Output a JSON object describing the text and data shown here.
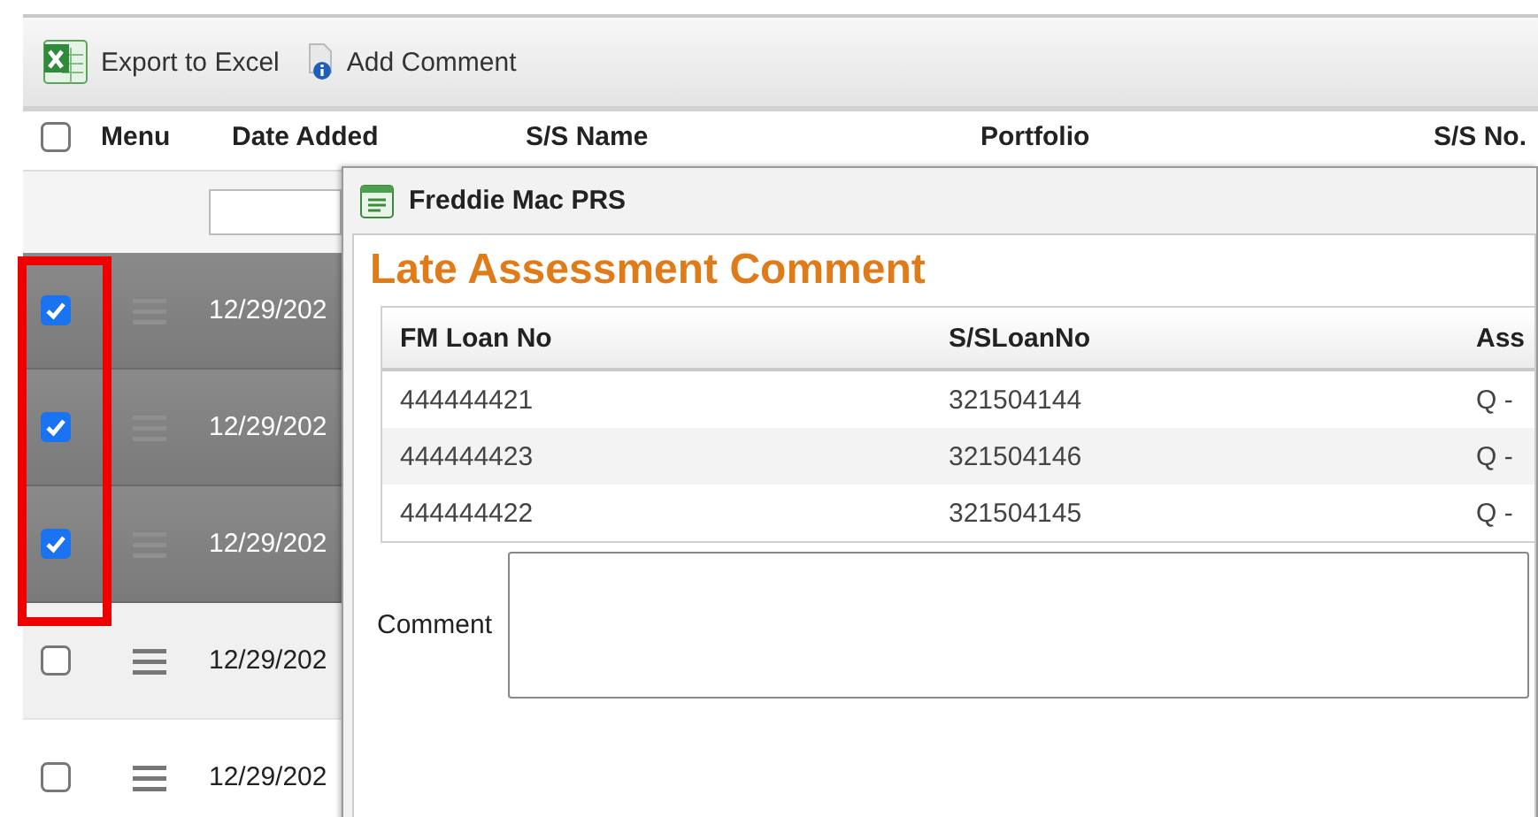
{
  "toolbar": [
    {
      "label": "Export to Excel",
      "kind": "excel"
    },
    {
      "label": "Add Comment",
      "kind": "comment"
    }
  ],
  "grid": {
    "select_all": {
      "checked": false
    },
    "columns": [
      "Menu",
      "Date Added",
      "S/S Name",
      "Portfolio",
      "S/S No."
    ],
    "rows": [
      {
        "checked": true,
        "date_added": "12/29/202"
      },
      {
        "checked": true,
        "date_added": "12/29/202"
      },
      {
        "checked": true,
        "date_added": "12/29/202"
      },
      {
        "checked": false,
        "date_added": "12/29/202"
      },
      {
        "checked": false,
        "date_added": "12/29/202"
      }
    ]
  },
  "dialog": {
    "title": "Freddie Mac PRS",
    "heading": "Late Assessment Comment",
    "table": {
      "columns": [
        "FM Loan No",
        "S/SLoanNo",
        "Ass"
      ],
      "rows": [
        [
          "444444421",
          "321504144",
          "Q -"
        ],
        [
          "444444423",
          "321504146",
          "Q -"
        ],
        [
          "444444422",
          "321504145",
          "Q -"
        ]
      ]
    },
    "comment_label": "Comment"
  }
}
